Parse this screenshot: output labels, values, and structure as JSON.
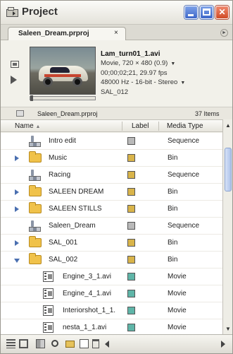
{
  "window": {
    "title": "Project",
    "app_icon": "project-panel-icon"
  },
  "tab": {
    "label": "Saleen_Dream.prproj",
    "close_glyph": "×",
    "menu_glyph": "►"
  },
  "preview": {
    "clip_name": "Lam_turn01_1.avi",
    "line1": "Movie, 720 × 480 (0.9)",
    "line2": "00;00;02;21, 29.97 fps",
    "line3": "48000 Hz - 16-bit - Stereo",
    "line4": "SAL_012",
    "dropdown_glyph": "▼"
  },
  "info": {
    "project_name": "Saleen_Dream.prproj",
    "item_count": "37 Items"
  },
  "columns": {
    "name": "Name",
    "sort_glyph": "▲",
    "label": "Label",
    "media_type": "Media Type"
  },
  "colors": {
    "label_gray": "#b9b9b9",
    "label_gold": "#d9b44a",
    "label_teal": "#5fb5a8"
  },
  "items": [
    {
      "name": "Intro edit",
      "kind": "sequence",
      "label_color": "#b9b9b9",
      "type": "Sequence",
      "indent": 0,
      "expand": "none"
    },
    {
      "name": "Music",
      "kind": "bin",
      "label_color": "#d9b44a",
      "type": "Bin",
      "indent": 0,
      "expand": "collapsed"
    },
    {
      "name": "Racing",
      "kind": "sequence",
      "label_color": "#d9b44a",
      "type": "Sequence",
      "indent": 0,
      "expand": "none"
    },
    {
      "name": "SALEEN DREAM",
      "kind": "bin",
      "label_color": "#d9b44a",
      "type": "Bin",
      "indent": 0,
      "expand": "collapsed"
    },
    {
      "name": "SALEEN STILLS",
      "kind": "bin",
      "label_color": "#d9b44a",
      "type": "Bin",
      "indent": 0,
      "expand": "collapsed"
    },
    {
      "name": "Saleen_Dream",
      "kind": "sequence",
      "label_color": "#b9b9b9",
      "type": "Sequence",
      "indent": 0,
      "expand": "none"
    },
    {
      "name": "SAL_001",
      "kind": "bin",
      "label_color": "#d9b44a",
      "type": "Bin",
      "indent": 0,
      "expand": "collapsed"
    },
    {
      "name": "SAL_002",
      "kind": "bin",
      "label_color": "#d9b44a",
      "type": "Bin",
      "indent": 0,
      "expand": "expanded"
    },
    {
      "name": "Engine_3_1.avi",
      "kind": "movie",
      "label_color": "#5fb5a8",
      "type": "Movie",
      "indent": 1,
      "expand": "none"
    },
    {
      "name": "Engine_4_1.avi",
      "kind": "movie",
      "label_color": "#5fb5a8",
      "type": "Movie",
      "indent": 1,
      "expand": "none"
    },
    {
      "name": "Interiorshot_1_1.",
      "kind": "movie",
      "label_color": "#5fb5a8",
      "type": "Movie",
      "indent": 1,
      "expand": "none"
    },
    {
      "name": "nesta_1_1.avi",
      "kind": "movie",
      "label_color": "#5fb5a8",
      "type": "Movie",
      "indent": 1,
      "expand": "none"
    }
  ],
  "toolbar": {
    "icons": [
      "list-view-icon",
      "icon-view-icon",
      "automate-to-sequence-icon",
      "find-icon",
      "new-bin-icon",
      "new-item-icon",
      "clear-icon",
      "scroll-left-icon",
      "scroll-right-icon"
    ]
  }
}
